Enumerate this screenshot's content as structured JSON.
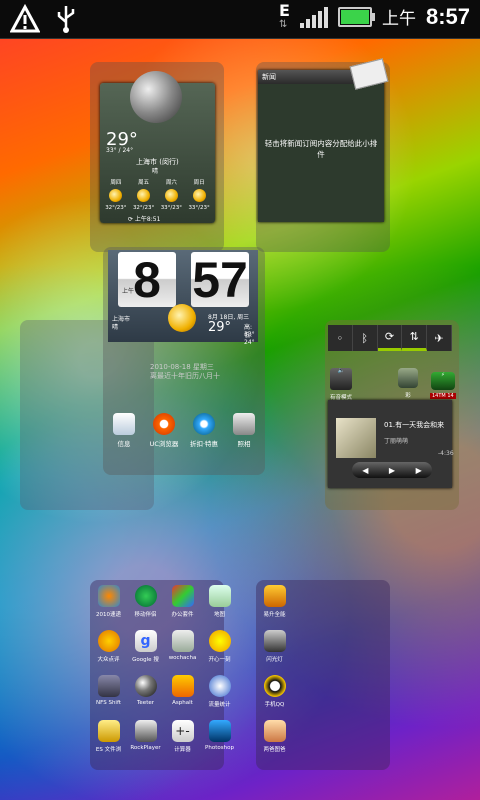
{
  "status_bar": {
    "network_type": "E",
    "ampm": "上午",
    "time": "8:57"
  },
  "screen1": {
    "weather": {
      "temp": "29°",
      "temp_range": "33° / 24°",
      "city": "上海市 (闵行)",
      "condition": "晴",
      "forecast": [
        {
          "day": "周四",
          "range": "32°/23°"
        },
        {
          "day": "周五",
          "range": "32°/23°"
        },
        {
          "day": "周六",
          "range": "33°/23°"
        },
        {
          "day": "周日",
          "range": "33°/23°"
        }
      ],
      "update": "⟳ 上午8:51"
    },
    "news": {
      "title": "新闻",
      "body": "轻击将新闻订阅内容分配给此小排件"
    }
  },
  "screen2": {
    "clock": {
      "hour": "8",
      "minute": "57",
      "ampm": "上午",
      "city": "上海市",
      "condition": "晴",
      "date": "8月 18日, 周三",
      "temp": "29°",
      "high": "高: 33°",
      "low": "低: 24°"
    },
    "note_line1": "2010-08-18 星期三",
    "note_line2": "离最近十年旧历八月十",
    "apps": [
      {
        "label": "信息",
        "icon": "messages-icon"
      },
      {
        "label": "UC浏览器",
        "icon": "uc-browser-icon"
      },
      {
        "label": "折扣·特惠",
        "icon": "ie-icon"
      },
      {
        "label": "照相",
        "icon": "camera-icon"
      }
    ]
  },
  "screen3": {
    "quick_toggles": [
      "wifi",
      "bluetooth",
      "sync",
      "data",
      "airplane"
    ],
    "apps": [
      {
        "label": "有音模式",
        "icon": "sound-mode-icon"
      },
      {
        "label": "彩",
        "icon": "contact-icon"
      },
      {
        "label": "",
        "icon": "battery-widget-icon",
        "badge": "14TM 14"
      }
    ],
    "music": {
      "track": "01.有一天我会和来",
      "artist": "丁丽萌萌",
      "time": "-4:36"
    }
  },
  "screen4": {
    "apps": [
      {
        "label": "2010速递",
        "icon": "travel-icon"
      },
      {
        "label": "移动伴侣",
        "icon": "mobile-partner-icon"
      },
      {
        "label": "办公套件",
        "icon": "office-suite-icon"
      },
      {
        "label": "地图",
        "icon": "maps-icon"
      },
      {
        "label": "大众点评",
        "icon": "dianping-icon"
      },
      {
        "label": "Google 搜",
        "icon": "google-icon"
      },
      {
        "label": "wochacha",
        "icon": "wochacha-icon"
      },
      {
        "label": "开心一刻",
        "icon": "smiley-icon"
      },
      {
        "label": "NFS Shift",
        "icon": "nfs-shift-icon"
      },
      {
        "label": "Teeter",
        "icon": "teeter-icon"
      },
      {
        "label": "Asphalt",
        "icon": "asphalt-icon"
      },
      {
        "label": "流量统计",
        "icon": "traffic-stats-icon"
      },
      {
        "label": "ES 文件浏",
        "icon": "es-file-icon"
      },
      {
        "label": "RockPlayer",
        "icon": "rockplayer-icon"
      },
      {
        "label": "计算器",
        "icon": "calculator-icon"
      },
      {
        "label": "Photoshop",
        "icon": "photoshop-icon"
      }
    ]
  },
  "screen5": {
    "apps": [
      {
        "label": "易升全能",
        "icon": "music-app-icon"
      },
      {
        "label": "闪光灯",
        "icon": "flashlight-icon"
      },
      {
        "label": "手机QQ",
        "icon": "qq-icon"
      },
      {
        "label": "两爸图爸",
        "icon": "photo-app-icon"
      }
    ]
  }
}
